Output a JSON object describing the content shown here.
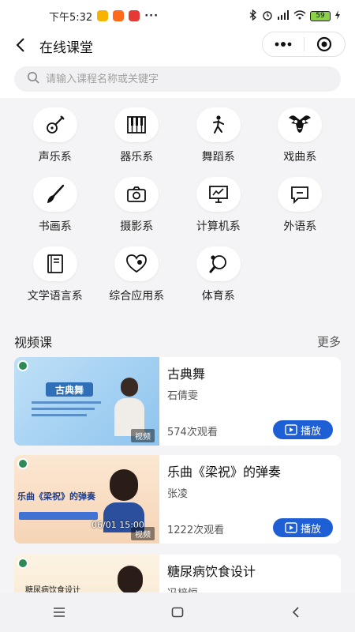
{
  "status_bar": {
    "time": "下午5:32",
    "dots": "···",
    "battery": "59",
    "hd": "HD"
  },
  "nav": {
    "title": "在线课堂"
  },
  "search": {
    "placeholder": "请输入课程名称或关键字"
  },
  "categories": [
    {
      "label": "声乐系",
      "icon": "guitar-icon"
    },
    {
      "label": "器乐系",
      "icon": "piano-icon"
    },
    {
      "label": "舞蹈系",
      "icon": "dancer-icon"
    },
    {
      "label": "戏曲系",
      "icon": "opera-mask-icon"
    },
    {
      "label": "书画系",
      "icon": "brush-icon"
    },
    {
      "label": "摄影系",
      "icon": "camera-icon"
    },
    {
      "label": "计算机系",
      "icon": "monitor-icon"
    },
    {
      "label": "外语系",
      "icon": "chat-bubble-icon"
    },
    {
      "label": "文学语言系",
      "icon": "book-icon"
    },
    {
      "label": "综合应用系",
      "icon": "heart-tag-icon"
    },
    {
      "label": "体育系",
      "icon": "ping-pong-icon"
    }
  ],
  "video_section": {
    "title": "视频课",
    "more": "更多"
  },
  "courses": [
    {
      "title": "古典舞",
      "teacher": "石倩雯",
      "views": "574次观看",
      "play": "播放",
      "tag": "视频",
      "thumb_title": "古典舞"
    },
    {
      "title": "乐曲《梁祝》的弹奏",
      "teacher": "张凌",
      "views": "1222次观看",
      "play": "播放",
      "tag": "视频",
      "thumb_title": "乐曲《梁祝》的弹奏",
      "thumb_date": "06/01 15:00"
    },
    {
      "title": "糖尿病饮食设计",
      "teacher": "冯梓恒",
      "thumb_title": "糖尿病饮食设计"
    }
  ],
  "colors": {
    "accent": "#1f5fd6",
    "background": "#f4f4f6"
  }
}
